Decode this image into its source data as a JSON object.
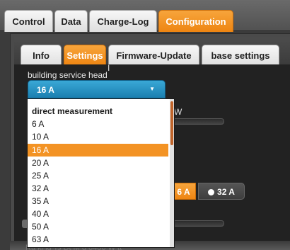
{
  "main_tabs": [
    {
      "label": "Control",
      "active": false
    },
    {
      "label": "Data",
      "active": false
    },
    {
      "label": "Charge-Log",
      "active": false
    },
    {
      "label": "Configuration",
      "active": true
    }
  ],
  "sub_tabs": [
    {
      "label": "Info",
      "active": false
    },
    {
      "label": "Settings",
      "active": true
    },
    {
      "label": "Firmware-Update",
      "active": false
    },
    {
      "label": "base settings",
      "active": false
    }
  ],
  "building_service": {
    "label": "building service head",
    "selected_value": "16 A"
  },
  "dropdown": {
    "header": "direct measurement",
    "options": [
      "6 A",
      "10 A",
      "16 A",
      "20 A",
      "25 A",
      "32 A",
      "35 A",
      "40 A",
      "50 A",
      "63 A"
    ],
    "selected": "16 A"
  },
  "background": {
    "partial_text": "W",
    "segment_selected_fragment": "6 A",
    "segment_other": "32 A",
    "bottom_text_fragment": "Ra ki ld Ts Dt M d   0400 W tt"
  },
  "colors": {
    "accent_orange": "#f39324",
    "select_blue": "#1f8ec4"
  }
}
